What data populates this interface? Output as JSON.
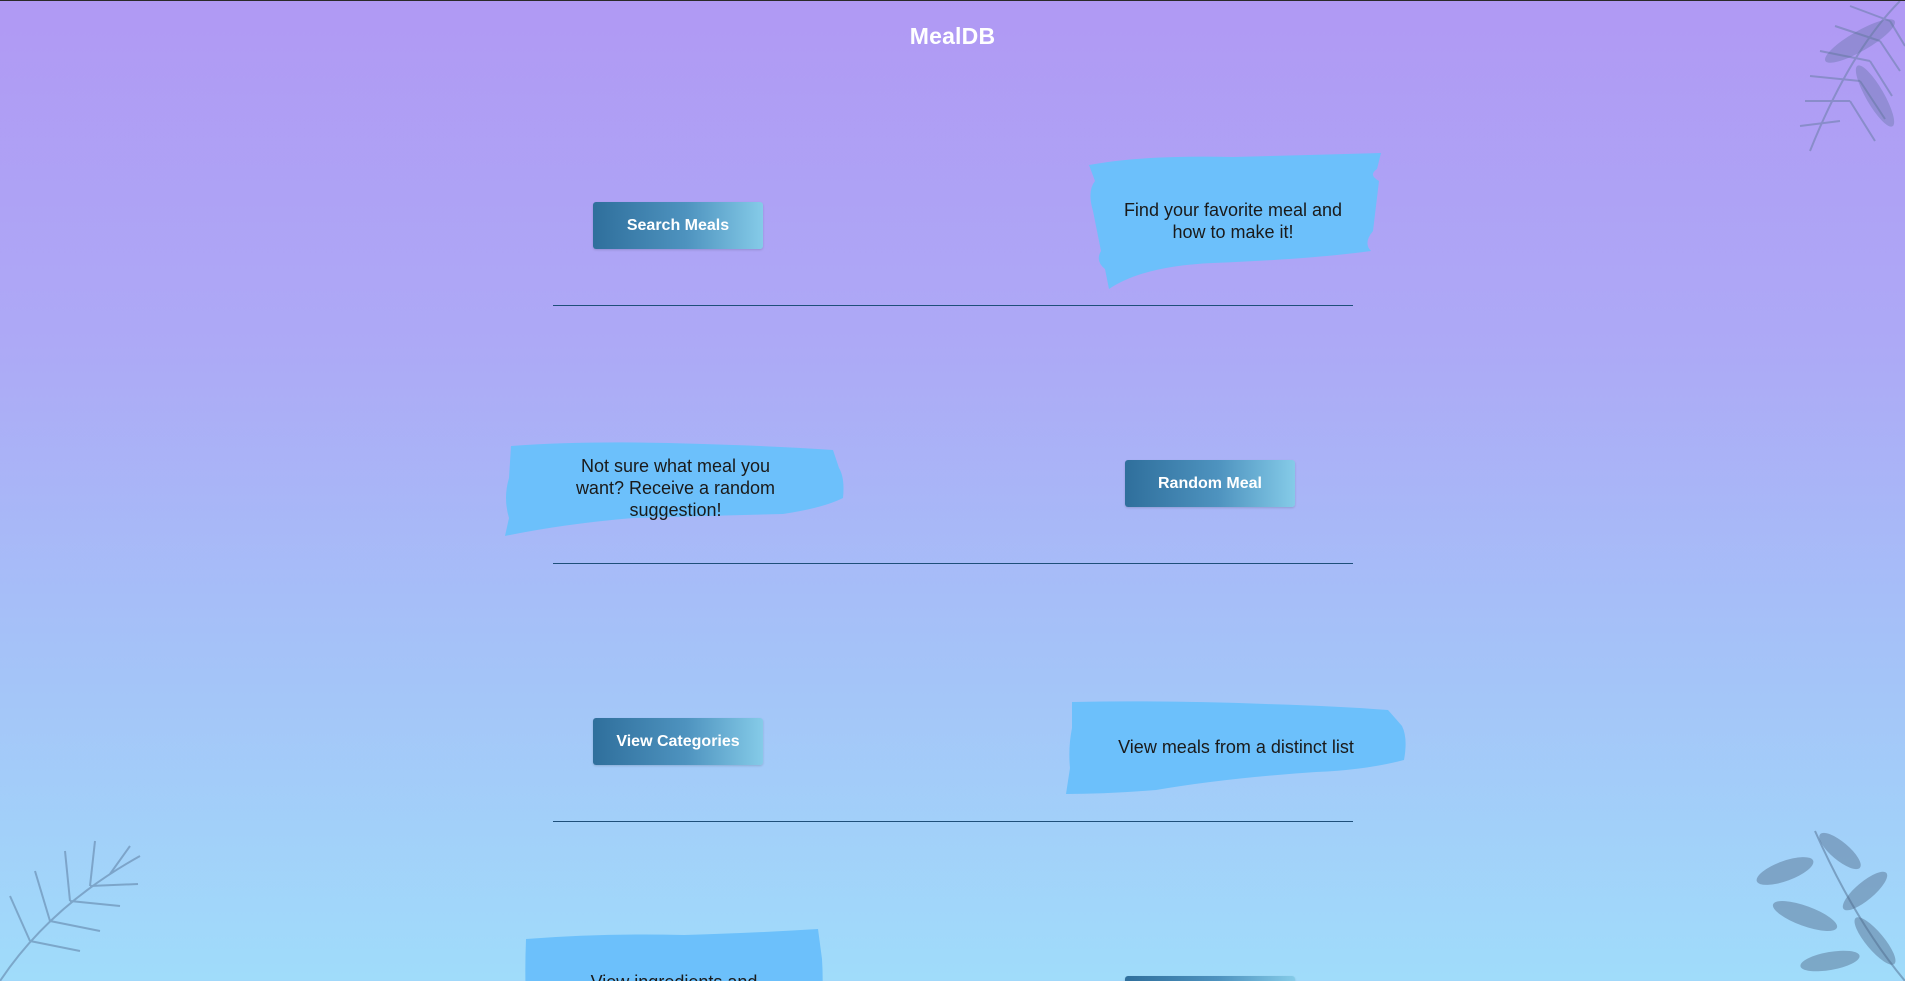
{
  "header": {
    "title": "MealDB"
  },
  "sections": [
    {
      "button_label": "Search Meals",
      "description": "Find your favorite meal and how to make it!"
    },
    {
      "button_label": "Random Meal",
      "description": "Not sure what meal you want? Receive a random suggestion!"
    },
    {
      "button_label": "View Categories",
      "description": "View meals from a distinct list"
    },
    {
      "button_label": "",
      "description": "View ingredients and"
    }
  ],
  "colors": {
    "brush": "#6cc0fb",
    "button_start": "#2f6f9c",
    "button_end": "#85cbe8",
    "divider": "#1e4f7a",
    "title": "#ffffff"
  },
  "decor": [
    "palm-leaf-top-right",
    "palm-leaf-bottom-left",
    "palm-leaf-bottom-right"
  ]
}
